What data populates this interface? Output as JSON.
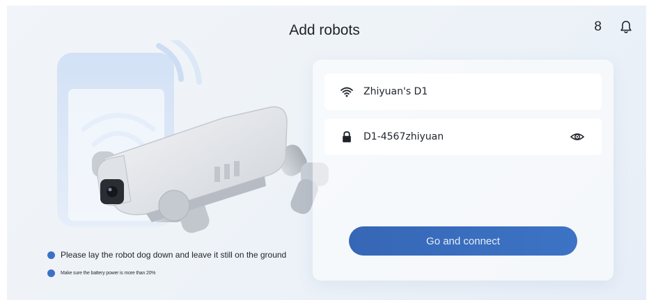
{
  "header": {
    "title": "Add robots",
    "count": "8",
    "bell_icon": "bell-icon"
  },
  "form": {
    "wifi_icon": "wifi-icon",
    "network_name": "Zhiyuan's D1",
    "lock_icon": "lock-icon",
    "password": "D1-4567zhiyuan",
    "visibility_icon": "eye-icon",
    "connect_label": "Go and connect"
  },
  "tips": [
    {
      "text": "Please lay the robot dog down and leave it still on the ground"
    },
    {
      "text": "Make sure the battery power is more than 20%"
    }
  ],
  "colors": {
    "accent": "#3b6fc1",
    "background": "#eef3f8",
    "panel": "#ffffff"
  }
}
